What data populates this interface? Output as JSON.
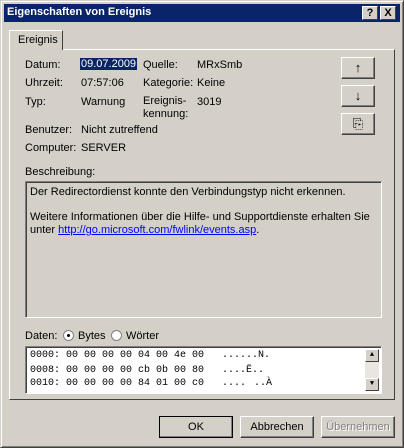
{
  "window": {
    "title": "Eigenschaften von Ereignis"
  },
  "titlebar": {
    "help_label": "?",
    "close_label": "X"
  },
  "tab": {
    "label": "Ereignis"
  },
  "fields": {
    "datum_label": "Datum:",
    "datum_value": "09.07.2009",
    "quelle_label": "Quelle:",
    "quelle_value": "MRxSmb",
    "uhrzeit_label": "Uhrzeit:",
    "uhrzeit_value": "07:57:06",
    "kategorie_label": "Kategorie:",
    "kategorie_value": "Keine",
    "typ_label": "Typ:",
    "typ_value": "Warnung",
    "ereignis_label_1": "Ereignis-",
    "ereignis_label_2": "kennung:",
    "ereignis_value": "3019",
    "benutzer_label": "Benutzer:",
    "benutzer_value": "Nicht zutreffend",
    "computer_label": "Computer:",
    "computer_value": "SERVER"
  },
  "side_buttons": {
    "up": "↑",
    "down": "↓",
    "copy": "⎘"
  },
  "description": {
    "label": "Beschreibung:",
    "line1": "Der Redirectordienst konnte den Verbindungstyp nicht erkennen.",
    "line2": "Weitere Informationen über die Hilfe- und Supportdienste erhalten Sie",
    "line3_prefix": "unter ",
    "link": "http://go.microsoft.com/fwlink/events.asp",
    "line3_suffix": "."
  },
  "data": {
    "label": "Daten:",
    "bytes_label": "Bytes",
    "words_label": "Wörter",
    "rows": [
      "0000: 00 00 00 00 04 00 4e 00   ......N.",
      "0008: 00 00 00 00 cb 0b 00 80   ....Ë..",
      "0010: 00 00 00 00 84 01 00 c0   ......À"
    ]
  },
  "footer": {
    "ok": "OK",
    "cancel": "Abbrechen",
    "apply": "Übernehmen"
  }
}
